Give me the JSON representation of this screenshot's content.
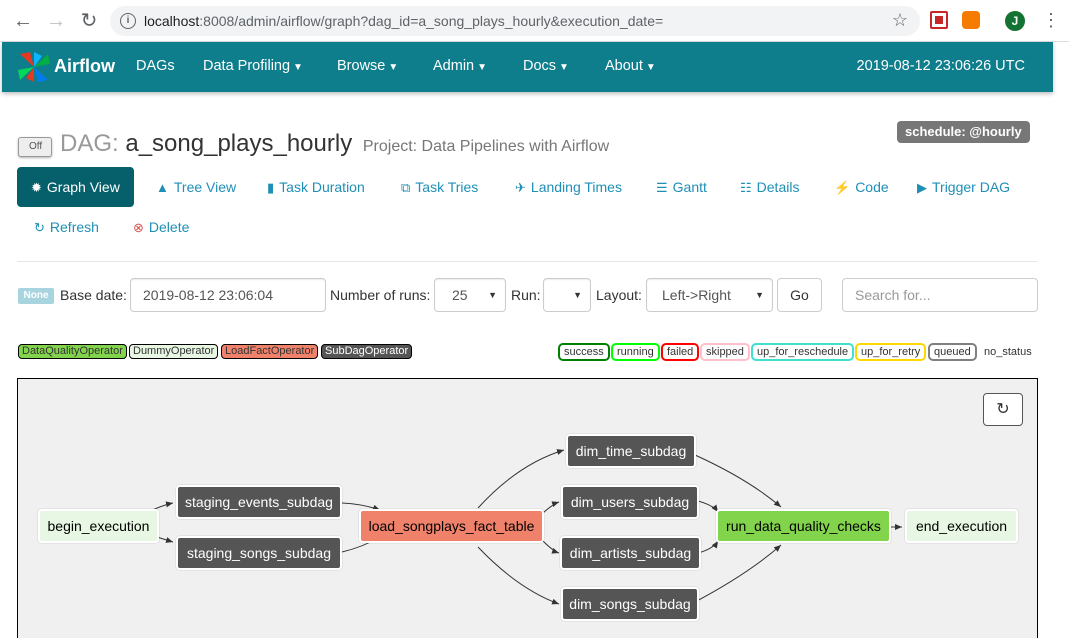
{
  "browser": {
    "url_host": "localhost",
    "url_rest": ":8008/admin/airflow/graph?dag_id=a_song_plays_hourly&execution_date=",
    "avatar_letter": "J"
  },
  "navbar": {
    "brand": "Airflow",
    "items": [
      "DAGs",
      "Data Profiling",
      "Browse",
      "Admin",
      "Docs",
      "About"
    ],
    "datetime": "2019-08-12 23:06:26 UTC",
    "color": "#0e7d8c"
  },
  "dag": {
    "toggle": "Off",
    "label": "DAG:",
    "name": "a_song_plays_hourly",
    "project": "Project: Data Pipelines with Airflow",
    "schedule": "schedule: @hourly"
  },
  "tabs": [
    {
      "label": "Graph View",
      "icon": "asterisk-icon"
    },
    {
      "label": "Tree View",
      "icon": "tree-icon"
    },
    {
      "label": "Task Duration",
      "icon": "bar-chart-icon"
    },
    {
      "label": "Task Tries",
      "icon": "duplicate-icon"
    },
    {
      "label": "Landing Times",
      "icon": "plane-icon"
    },
    {
      "label": "Gantt",
      "icon": "align-left-icon"
    },
    {
      "label": "Details",
      "icon": "list-icon"
    },
    {
      "label": "Code",
      "icon": "flash-icon"
    },
    {
      "label": "Trigger DAG",
      "icon": "play-circle-icon"
    },
    {
      "label": "Refresh",
      "icon": "refresh-icon"
    },
    {
      "label": "Delete",
      "icon": "remove-circle-icon"
    }
  ],
  "form": {
    "state_badge": "None",
    "base_date_label": "Base date:",
    "base_date_value": "2019-08-12 23:06:04",
    "num_runs_label": "Number of runs:",
    "num_runs_value": "25",
    "run_label": "Run:",
    "run_value": "",
    "layout_label": "Layout:",
    "layout_value": "Left->Right",
    "go_label": "Go",
    "search_placeholder": "Search for..."
  },
  "operators": [
    {
      "label": "DataQualityOperator",
      "color": "#83d44d"
    },
    {
      "label": "DummyOperator",
      "color": "#e8f7e4"
    },
    {
      "label": "LoadFactOperator",
      "color": "#f0826b"
    },
    {
      "label": "SubDagOperator",
      "color": "#555555"
    }
  ],
  "statuses": [
    {
      "label": "success",
      "color": "#008000"
    },
    {
      "label": "running",
      "color": "#00ff00"
    },
    {
      "label": "failed",
      "color": "#ff0000"
    },
    {
      "label": "skipped",
      "color": "#ffc0cb"
    },
    {
      "label": "up_for_reschedule",
      "color": "#40e0d0"
    },
    {
      "label": "up_for_retry",
      "color": "#ffd700"
    },
    {
      "label": "queued",
      "color": "#808080"
    },
    {
      "label": "no_status",
      "color": "#ffffff"
    }
  ],
  "nodes": {
    "begin_execution": "begin_execution",
    "staging_events_subdag": "staging_events_subdag",
    "staging_songs_subdag": "staging_songs_subdag",
    "load_songplays_fact_table": "load_songplays_fact_table",
    "dim_time_subdag": "dim_time_subdag",
    "dim_users_subdag": "dim_users_subdag",
    "dim_artists_subdag": "dim_artists_subdag",
    "dim_songs_subdag": "dim_songs_subdag",
    "run_data_quality_checks": "run_data_quality_checks",
    "end_execution": "end_execution"
  }
}
